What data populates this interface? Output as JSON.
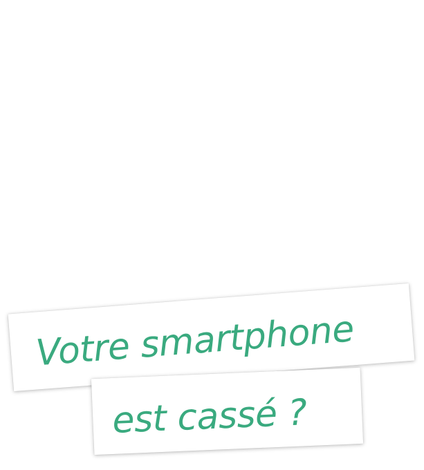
{
  "banner": {
    "line1": "Votre smartphone",
    "line2": "est cassé ?"
  },
  "colors": {
    "background": "#ffffff",
    "text": "#3aaa7f",
    "card": "#ffffff"
  }
}
